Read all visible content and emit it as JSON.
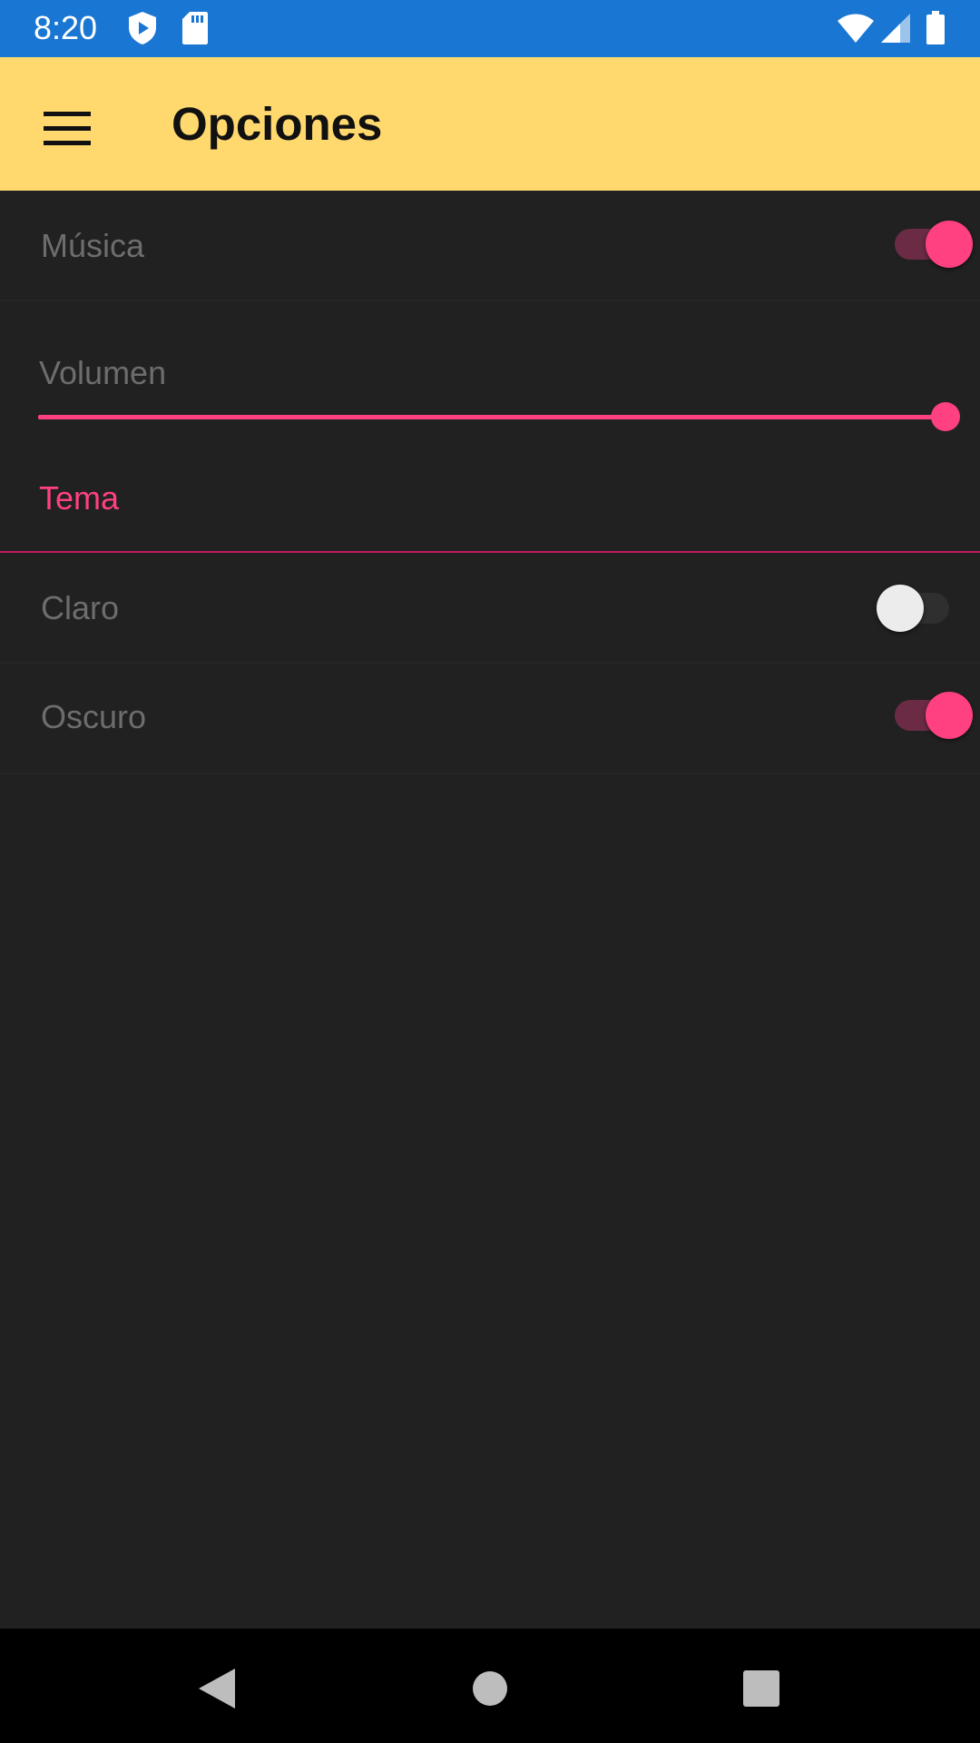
{
  "status_bar": {
    "time": "8:20",
    "left_icons": [
      "shield-play-icon",
      "sd-card-icon"
    ],
    "right_icons": [
      "wifi-icon",
      "signal-icon",
      "battery-icon"
    ],
    "color": "#1976D2"
  },
  "app_bar": {
    "title": "Opciones",
    "menu_icon": "hamburger-menu-icon",
    "color": "#FFD86E"
  },
  "settings": {
    "music": {
      "label": "Música",
      "enabled": true
    },
    "volume": {
      "label": "Volumen",
      "value": 1.0
    },
    "theme": {
      "section_title": "Tema",
      "light": {
        "label": "Claro",
        "enabled": false
      },
      "dark": {
        "label": "Oscuro",
        "enabled": true
      }
    }
  },
  "accent_color": "#FF4081",
  "nav_bar": {
    "buttons": [
      "back-icon",
      "home-icon",
      "recents-icon"
    ]
  }
}
